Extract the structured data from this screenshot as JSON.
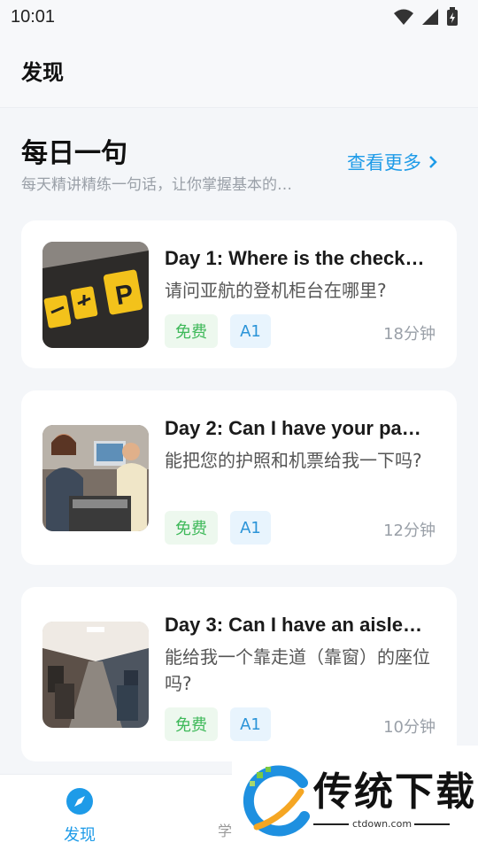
{
  "status_bar": {
    "time": "10:01"
  },
  "appbar": {
    "title": "发现"
  },
  "section": {
    "title": "每日一句",
    "subtitle": "每天精讲精练一句话，让你掌握基本的…",
    "see_more": "查看更多"
  },
  "cards": [
    {
      "title": "Day 1: Where is the check…",
      "desc": "请问亚航的登机柜台在哪里?",
      "tag_free": "免费",
      "tag_level": "A1",
      "duration": "18分钟"
    },
    {
      "title": "Day 2: Can I have your pa…",
      "desc": "能把您的护照和机票给我一下吗?",
      "tag_free": "免费",
      "tag_level": "A1",
      "duration": "12分钟"
    },
    {
      "title": "Day 3: Can I have an aisle…",
      "desc": "能给我一个靠走道（靠窗）的座位吗?",
      "tag_free": "免费",
      "tag_level": "A1",
      "duration": "10分钟"
    }
  ],
  "bottom_nav": {
    "discover_label": "发现",
    "learn_label": "学"
  },
  "watermark": {
    "brand": "传统下载",
    "url": "ctdown.com"
  },
  "colors": {
    "accent": "#1e9be8",
    "free_tag": "#3fb95a",
    "level_tag": "#2b94d8"
  },
  "icons": [
    "wifi-icon",
    "signal-icon",
    "battery-icon",
    "chevron-right-icon",
    "compass-icon"
  ]
}
